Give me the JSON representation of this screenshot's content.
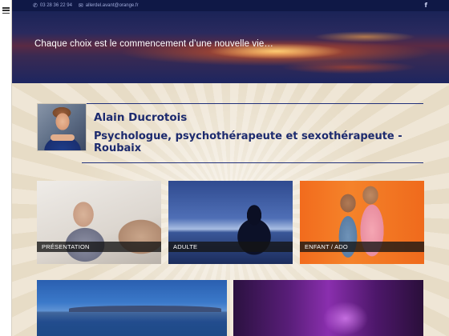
{
  "topbar": {
    "phone": "03 28 36 22 94",
    "email": "allerdel.avant@orange.fr",
    "phone_icon": "phone-icon",
    "email_icon": "envelope-icon",
    "social_icon": "facebook-icon",
    "social_glyph": "f"
  },
  "banner": {
    "tagline": "Chaque choix est le commencement d’une nouvelle vie…"
  },
  "profile": {
    "name": "Alain Ducrotois",
    "subtitle": "Psychologue, psychothérapeute et sexothérapeute - Roubaix"
  },
  "tiles": [
    {
      "label": "PRÉSENTATION"
    },
    {
      "label": "ADULTE"
    },
    {
      "label": "ENFANT / ADO"
    }
  ],
  "colors": {
    "topbar": "#0f1846",
    "heading": "#1c2a6e",
    "rule": "#20307a",
    "background": "#efe6d6"
  }
}
